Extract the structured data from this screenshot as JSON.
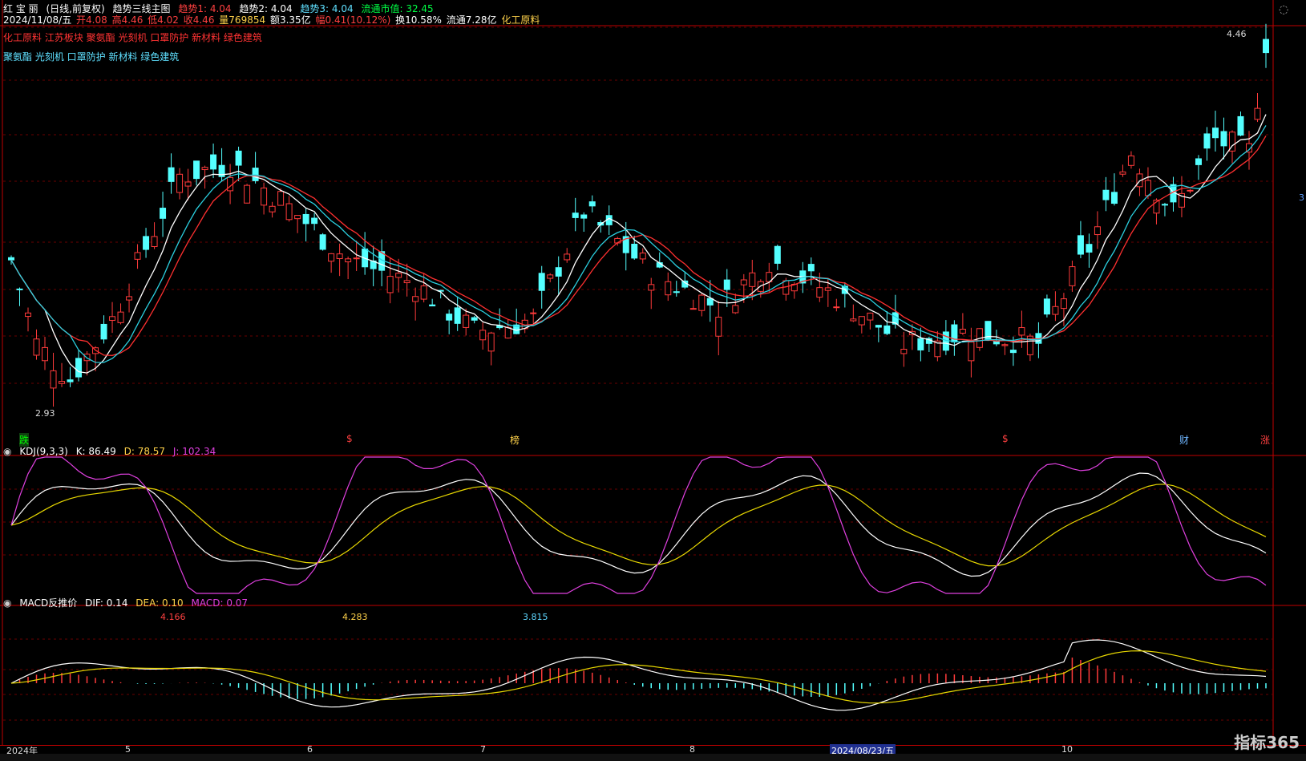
{
  "header": {
    "stock_name": "红 宝 丽",
    "view_mode": "(日线,前复权)",
    "indicator_name": "趋势三线主图",
    "trend1": "趋势1: 4.04",
    "trend2": "趋势2: 4.04",
    "trend3": "趋势3: 4.04",
    "mcap": "流通市值: 32.45",
    "date": "2024/11/08/五",
    "open": "开4.08",
    "high": "高4.46",
    "low": "低4.02",
    "close": "收4.46",
    "volume": "量769854",
    "amount": "额3.35亿",
    "change": "幅0.41(10.12%)",
    "turnover": "换10.58%",
    "float_shares": "流通7.28亿",
    "industry": "化工原料"
  },
  "concepts_red": "化工原料 江苏板块 聚氨酯 光刻机 口罩防护 新材料 绿色建筑",
  "concepts_cyan": "聚氨酯 光刻机 口罩防护 新材料 绿色建筑",
  "price_labels": {
    "high": "4.46",
    "low": "2.93"
  },
  "markers": [
    {
      "text": "跌",
      "color": "#00ff00"
    },
    {
      "text": "$",
      "color": "#ff4040"
    },
    {
      "text": "榜",
      "color": "#ffd24a"
    },
    {
      "text": "$",
      "color": "#ff4040"
    },
    {
      "text": "财",
      "color": "#6fb6ff"
    },
    {
      "text": "涨",
      "color": "#ff4040"
    }
  ],
  "kdj": {
    "title": "KDJ(9,3,3)",
    "k": "K: 86.49",
    "d": "D: 78.57",
    "j": "J: 102.34"
  },
  "macd": {
    "title": "MACD反推价",
    "dif": "DIF: 0.14",
    "dea": "DEA: 0.10",
    "macd": "MACD: 0.07",
    "prices": [
      {
        "text": "4.166",
        "color": "#ff4040"
      },
      {
        "text": "4.283",
        "color": "#ffd24a"
      },
      {
        "text": "3.815",
        "color": "#5fd7ff"
      }
    ]
  },
  "x_axis": {
    "labels": [
      "2024年",
      "5",
      "6",
      "7",
      "8",
      "10"
    ],
    "cursor_date": "2024/08/23/五"
  },
  "right_axis": {
    "mark": "3"
  },
  "logo": "指标365",
  "colors": {
    "up": "#ff3b3b",
    "down": "#54ffff",
    "ma_white": "#ffffff",
    "ma_red": "#ff3030",
    "ma_cyan": "#2bd0e0",
    "k": "#ffffff",
    "d": "#e8d800",
    "j": "#e040e0",
    "grid": "#6a0000"
  }
}
